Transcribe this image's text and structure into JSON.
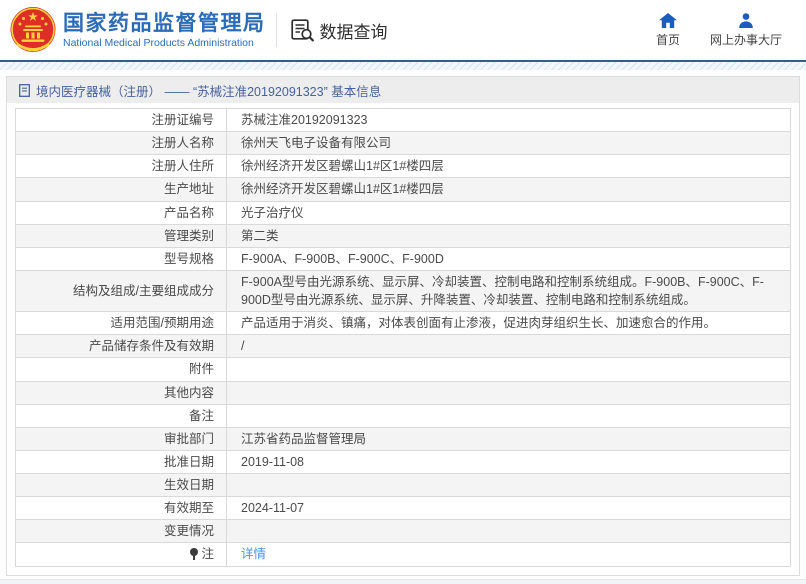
{
  "header": {
    "agency_title": "国家药品监督管理局",
    "agency_subtitle": "National Medical Products Administration",
    "section_label": "数据查询",
    "nav_home": "首页",
    "nav_hall": "网上办事大厅"
  },
  "breadcrumb": {
    "path": "境内医疗器械（注册） —— “苏械注准20192091323” 基本信息"
  },
  "table": {
    "rows": [
      {
        "label": "注册证编号",
        "value": "苏械注准20192091323"
      },
      {
        "label": "注册人名称",
        "value": "徐州天飞电子设备有限公司"
      },
      {
        "label": "注册人住所",
        "value": "徐州经济开发区碧螺山1#区1#楼四层"
      },
      {
        "label": "生产地址",
        "value": "徐州经济开发区碧螺山1#区1#楼四层"
      },
      {
        "label": "产品名称",
        "value": "光子治疗仪"
      },
      {
        "label": "管理类别",
        "value": "第二类"
      },
      {
        "label": "型号规格",
        "value": "F-900A、F-900B、F-900C、F-900D"
      },
      {
        "label": "结构及组成/主要组成成分",
        "value": "F-900A型号由光源系统、显示屏、冷却装置、控制电路和控制系统组成。F-900B、F-900C、F-900D型号由光源系统、显示屏、升降装置、冷却装置、控制电路和控制系统组成。"
      },
      {
        "label": "适用范围/预期用途",
        "value": "产品适用于消炎、镇痛，对体表创面有止渗液，促进肉芽组织生长、加速愈合的作用。"
      },
      {
        "label": "产品储存条件及有效期",
        "value": "/"
      },
      {
        "label": "附件",
        "value": ""
      },
      {
        "label": "其他内容",
        "value": ""
      },
      {
        "label": "备注",
        "value": ""
      },
      {
        "label": "审批部门",
        "value": "江苏省药品监督管理局"
      },
      {
        "label": "批准日期",
        "value": "2019-11-08"
      },
      {
        "label": "生效日期",
        "value": ""
      },
      {
        "label": "有效期至",
        "value": "2024-11-07"
      },
      {
        "label": "变更情况",
        "value": ""
      },
      {
        "label": "注",
        "value": "详情",
        "link": true,
        "icon": "note-pin-icon"
      }
    ]
  },
  "colors": {
    "brand_blue": "#2b6cb8",
    "icon_blue": "#1d5cbf",
    "emblem_red": "#de2f26",
    "emblem_gold": "#ffd23c",
    "link_blue": "#4a90f3",
    "breadcrumb_text": "#44629b",
    "zebra_gray": "#f4f4f4"
  }
}
